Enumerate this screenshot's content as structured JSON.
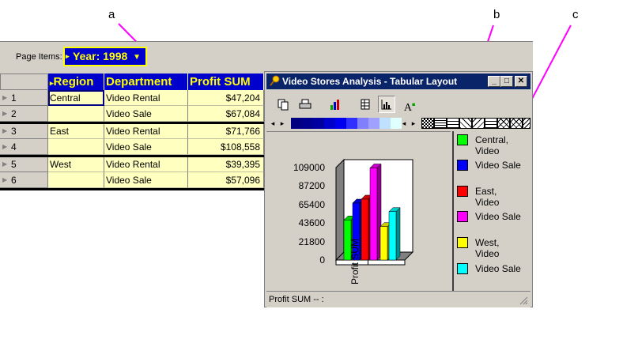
{
  "callouts": [
    "a",
    "b",
    "c"
  ],
  "page_items": {
    "label": "Page Items:",
    "year_value": "Year: 1998"
  },
  "grid": {
    "headers": [
      "Region",
      "Department",
      "Profit SUM"
    ],
    "rows": [
      {
        "num": "1",
        "region": "Central",
        "department": "Video Rental",
        "profit": "$47,204"
      },
      {
        "num": "2",
        "region": "",
        "department": "Video Sale",
        "profit": "$67,084"
      },
      {
        "num": "3",
        "region": "East",
        "department": "Video Rental",
        "profit": "$71,766"
      },
      {
        "num": "4",
        "region": "",
        "department": "Video Sale",
        "profit": "$108,558"
      },
      {
        "num": "5",
        "region": "West",
        "department": "Video Rental",
        "profit": "$39,395"
      },
      {
        "num": "6",
        "region": "",
        "department": "Video Sale",
        "profit": "$57,096"
      }
    ]
  },
  "chart_window": {
    "title": "Video Stores Analysis - Tabular Layout",
    "toolbar_icons": [
      "copy-icon",
      "print-icon",
      "chart-type-icon",
      "table-icon",
      "graph-icon",
      "font-icon"
    ],
    "status": "Profit SUM -- :",
    "swatch_colors": [
      "#000080",
      "#000090",
      "#0000a0",
      "#0000cc",
      "#0000ee",
      "#3030ff",
      "#8080ff",
      "#a0a0ff",
      "#c0e0ff",
      "#e0ffff"
    ],
    "legend": [
      {
        "line1": "Central,",
        "line2": "Video",
        "color": "#00ff00"
      },
      {
        "line1": "Video Sale",
        "line2": "",
        "color": "#0000ff"
      },
      {
        "line1": "East,",
        "line2": "Video",
        "color": "#ff0000"
      },
      {
        "line1": "Video Sale",
        "line2": "",
        "color": "#ff00ff"
      },
      {
        "line1": "West,",
        "line2": "Video",
        "color": "#ffff00"
      },
      {
        "line1": "Video Sale",
        "line2": "",
        "color": "#00ffff"
      }
    ]
  },
  "chart_data": {
    "type": "bar",
    "xlabel": "Profit SUM",
    "ylabel": "",
    "y_ticks": [
      "109000",
      "87200",
      "65400",
      "43600",
      "21800",
      "0"
    ],
    "ylim": [
      0,
      109000
    ],
    "series": [
      {
        "name": "Central, Video Rental",
        "value": 47204,
        "color": "#00ff00"
      },
      {
        "name": "Central, Video Sale",
        "value": 67084,
        "color": "#0000ff"
      },
      {
        "name": "East, Video Rental",
        "value": 71766,
        "color": "#ff0000"
      },
      {
        "name": "East, Video Sale",
        "value": 108558,
        "color": "#ff00ff"
      },
      {
        "name": "West, Video Rental",
        "value": 39395,
        "color": "#ffff00"
      },
      {
        "name": "West, Video Sale",
        "value": 57096,
        "color": "#00ffff"
      }
    ],
    "legend_position": "right"
  }
}
